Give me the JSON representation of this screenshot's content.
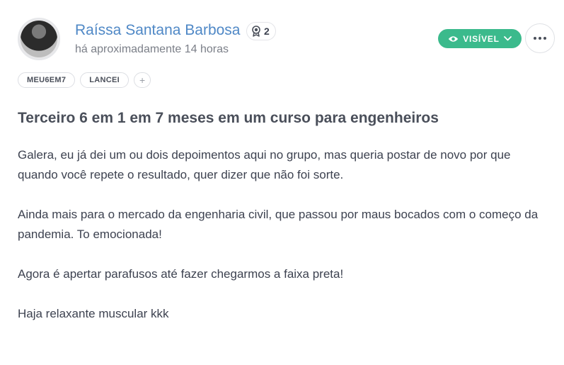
{
  "author": {
    "name": "Raíssa Santana Barbosa",
    "badge_count": "2",
    "timestamp": "há aproximadamente 14 horas"
  },
  "visibility": {
    "label": "VISÍVEL"
  },
  "tags": [
    {
      "label": "MEU6EM7"
    },
    {
      "label": "LANCEI"
    }
  ],
  "tag_add_label": "+",
  "post": {
    "title": "Terceiro 6 em 1 em 7 meses em um curso para engenheiros",
    "paragraphs": [
      "Galera, eu já dei um ou dois depoimentos aqui no grupo, mas queria postar de novo por que quando você repete o resultado, quer dizer que não foi sorte.",
      "Ainda mais para o mercado da engenharia civil, que passou por maus bocados com o começo da pandemia. To emocionada!",
      "Agora é apertar parafusos até fazer chegarmos a faixa preta!",
      "Haja relaxante muscular kkk"
    ]
  },
  "colors": {
    "author_name": "#4f88c6",
    "visibility_bg": "#3bba8c"
  },
  "icons": {
    "badge": "medal-icon",
    "visibility": "eye-icon",
    "dropdown": "chevron-down-icon",
    "more": "more-horizontal-icon"
  }
}
